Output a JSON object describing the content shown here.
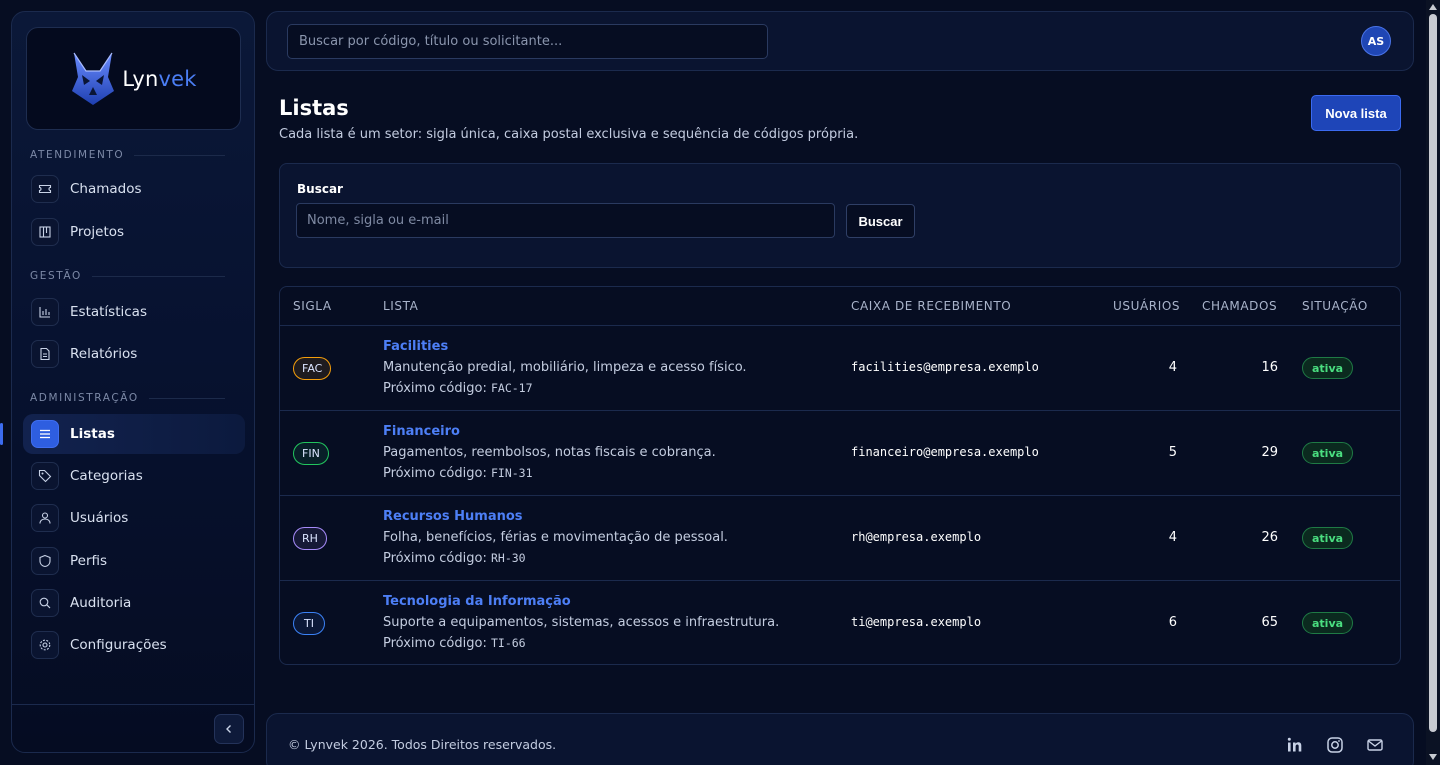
{
  "brand": {
    "name_prefix": "Lyn",
    "name_suffix": "vek",
    "accent": "#4b7ef5"
  },
  "sidebar": {
    "sections": [
      {
        "label": "ATENDIMENTO"
      },
      {
        "label": "GESTÃO"
      },
      {
        "label": "ADMINISTRAÇÃO"
      }
    ],
    "items": [
      {
        "label": "Chamados",
        "icon": "ticket-icon"
      },
      {
        "label": "Projetos",
        "icon": "kanban-icon"
      },
      {
        "label": "Estatísticas",
        "icon": "bar-chart-icon"
      },
      {
        "label": "Relatórios",
        "icon": "document-icon"
      },
      {
        "label": "Listas",
        "icon": "list-icon",
        "active": true
      },
      {
        "label": "Categorias",
        "icon": "tag-icon"
      },
      {
        "label": "Usuários",
        "icon": "user-icon"
      },
      {
        "label": "Perfis",
        "icon": "shield-icon"
      },
      {
        "label": "Auditoria",
        "icon": "search-icon"
      },
      {
        "label": "Configurações",
        "icon": "gear-icon"
      }
    ]
  },
  "topbar": {
    "search_placeholder": "Buscar por código, título ou solicitante...",
    "avatar_initials": "AS"
  },
  "header": {
    "title": "Listas",
    "subtitle": "Cada lista é um setor: sigla única, caixa postal exclusiva e sequência de códigos própria.",
    "new_button": "Nova lista"
  },
  "filter": {
    "label": "Buscar",
    "placeholder": "Nome, sigla ou e-mail",
    "button": "Buscar"
  },
  "table": {
    "columns": [
      "SIGLA",
      "LISTA",
      "CAIXA DE RECEBIMENTO",
      "USUÁRIOS",
      "CHAMADOS",
      "SITUAÇÃO"
    ],
    "next_code_label": "Próximo código:",
    "rows": [
      {
        "code": "FAC",
        "code_color": "#f59e0b",
        "name": "Facilities",
        "description": "Manutenção predial, mobiliário, limpeza e acesso físico.",
        "next_code": "FAC-17",
        "email": "facilities@empresa.exemplo",
        "users": "4",
        "tickets": "16",
        "status": "ativa"
      },
      {
        "code": "FIN",
        "code_color": "#22c55e",
        "name": "Financeiro",
        "description": "Pagamentos, reembolsos, notas fiscais e cobrança.",
        "next_code": "FIN-31",
        "email": "financeiro@empresa.exemplo",
        "users": "5",
        "tickets": "29",
        "status": "ativa"
      },
      {
        "code": "RH",
        "code_color": "#a78bfa",
        "name": "Recursos Humanos",
        "description": "Folha, benefícios, férias e movimentação de pessoal.",
        "next_code": "RH-30",
        "email": "rh@empresa.exemplo",
        "users": "4",
        "tickets": "26",
        "status": "ativa"
      },
      {
        "code": "TI",
        "code_color": "#3b82f6",
        "name": "Tecnologia da Informação",
        "description": "Suporte a equipamentos, sistemas, acessos e infraestrutura.",
        "next_code": "TI-66",
        "email": "ti@empresa.exemplo",
        "users": "6",
        "tickets": "65",
        "status": "ativa"
      }
    ]
  },
  "footer": {
    "copyright": "© Lynvek 2026. Todos Direitos reservados.",
    "icons": [
      "linkedin-icon",
      "instagram-icon",
      "mail-icon"
    ]
  }
}
